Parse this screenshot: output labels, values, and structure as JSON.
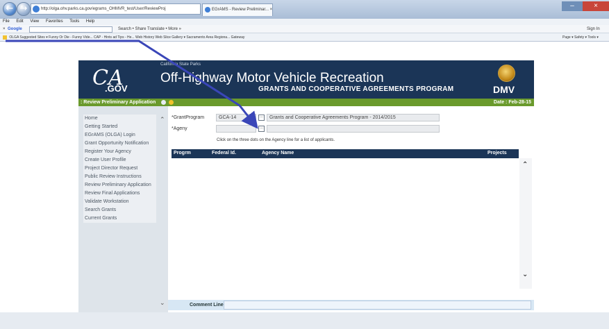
{
  "browser": {
    "address": "http://olga.ohv.parks.ca.gov/egrams_OHMVR_test/User/ReviewProj",
    "tab_title": "EGrAMS - Review Preliminar... ×",
    "menu": [
      "File",
      "Edit",
      "View",
      "Favorites",
      "Tools",
      "Help"
    ],
    "google_label": "Google",
    "google_tools": "Search  •   Share   Translate •  More »",
    "sign_in": "Sign In",
    "favorites": "OLGA   Suggested Sites ▾   Funny Or Die - Funny Vide...   CAP - Hints ad Tips - He...   Web History   Web Slice Gallery ▾   Sacramento Area Regiona...   Gateway",
    "ie_tools": "Page ▾   Safety ▾   Tools ▾"
  },
  "banner": {
    "subtitle": "California State Parks",
    "title": "Off-Highway Motor Vehicle Recreation",
    "program": "GRANTS AND COOPERATIVE AGREEMENTS PROGRAM",
    "logo_ca": "CA",
    "logo_gov": ".GOV",
    "dmv": "DMV"
  },
  "subheader": {
    "page_title": ": Review Preliminary Application",
    "date": "Date : Feb-28-15"
  },
  "nav": {
    "items": [
      "Home",
      "Getting Started",
      "EGrAMS (OLGA) Login",
      "Grant Opportunity Notification",
      "Register Your Agency",
      "Create User Profile",
      "Project Director Request",
      "Public Review Instructions",
      "Review Preliminary Application",
      "Review Final Applications",
      "Validate Workstation",
      "Search Grants",
      "Current Grants"
    ]
  },
  "form": {
    "grant_program_label": "*GrantProgram",
    "grant_program_code": "GCA-14",
    "grant_program_name": "Grants and Cooperative Agreements Program - 2014/2015",
    "agency_label": "*Ageny",
    "agency_value": "",
    "dots": "...",
    "hint": "Click on the three dots on the Agency line for a list of applicants."
  },
  "grid": {
    "columns": [
      "Progrm",
      "Federal Id.",
      "Agency Name",
      "Projects"
    ]
  },
  "comment": {
    "label": "Comment Line:"
  }
}
